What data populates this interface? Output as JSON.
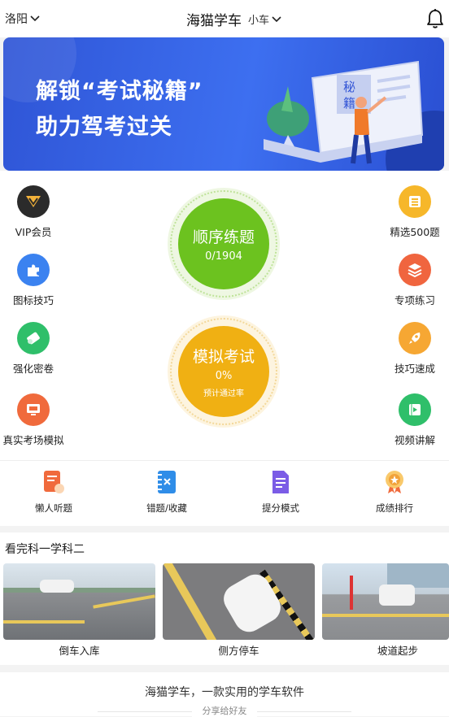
{
  "header": {
    "city": "洛阳",
    "title": "海猫学车",
    "vehicle": "小车",
    "icons": {
      "city_dropdown": "chevron-down-icon",
      "vehicle_dropdown": "chevron-down-icon",
      "notifications": "bell-icon"
    }
  },
  "banner": {
    "line1": "解锁“考试秘籍”",
    "line2": "助力驾考过关",
    "book_text1": "秘",
    "book_text2": "籍"
  },
  "features_left": [
    {
      "label": "VIP会员",
      "icon": "vip-diamond-icon",
      "color": "#2b2b2b"
    },
    {
      "label": "图标技巧",
      "icon": "puzzle-icon",
      "color": "#3b82f0"
    },
    {
      "label": "强化密卷",
      "icon": "scroll-icon",
      "color": "#2fbf6a"
    },
    {
      "label": "真实考场模拟",
      "icon": "monitor-icon",
      "color": "#f06a3c"
    }
  ],
  "features_right": [
    {
      "label": "精选500题",
      "icon": "list-icon",
      "color": "#f6b72a"
    },
    {
      "label": "专项练习",
      "icon": "layers-icon",
      "color": "#f0653f"
    },
    {
      "label": "技巧速成",
      "icon": "rocket-icon",
      "color": "#f6a733"
    },
    {
      "label": "视频讲解",
      "icon": "video-icon",
      "color": "#2fbf6a"
    }
  ],
  "practice": {
    "title": "顺序练题",
    "progress": "0/1904",
    "done": 0,
    "total": 1904,
    "color": "#6cc21f"
  },
  "exam": {
    "title": "模拟考试",
    "rate": "0%",
    "caption": "预计通过率",
    "color": "#f0b013"
  },
  "tools": [
    {
      "label": "懒人听题",
      "icon": "document-headphone-icon",
      "color": "#f06a3c"
    },
    {
      "label": "错题/收藏",
      "icon": "notebook-icon",
      "color": "#2f8de8"
    },
    {
      "label": "提分模式",
      "icon": "score-sheet-icon",
      "color": "#7b5ce6"
    },
    {
      "label": "成绩排行",
      "icon": "medal-icon",
      "color": "#f2a23a"
    }
  ],
  "subject2": {
    "title": "看完科一学科二",
    "items": [
      {
        "label": "倒车入库"
      },
      {
        "label": "侧方停车"
      },
      {
        "label": "坡道起步"
      }
    ]
  },
  "footer": {
    "slogan": "海猫学车，一款实用的学车软件",
    "share": "分享给好友"
  }
}
